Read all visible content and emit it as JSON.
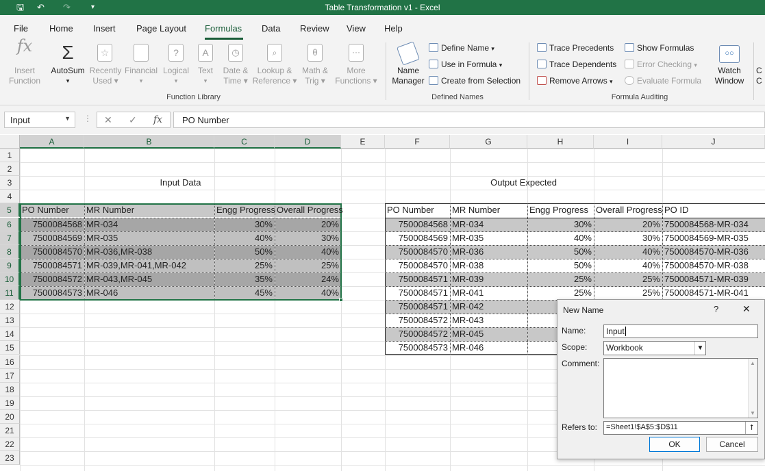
{
  "window": {
    "title": "Table Transformation v1  -  Excel"
  },
  "menu": [
    "File",
    "Home",
    "Insert",
    "Page Layout",
    "Formulas",
    "Data",
    "Review",
    "View",
    "Help"
  ],
  "ribbon": {
    "insert_function": [
      "Insert",
      "Function"
    ],
    "autosum": "AutoSum",
    "recently_used": [
      "Recently",
      "Used"
    ],
    "financial": "Financial",
    "logical": "Logical",
    "text": "Text",
    "date_time": [
      "Date &",
      "Time"
    ],
    "lookup": [
      "Lookup &",
      "Reference"
    ],
    "math": [
      "Math &",
      "Trig"
    ],
    "more": [
      "More",
      "Functions"
    ],
    "function_library": "Function Library",
    "name_manager": [
      "Name",
      "Manager"
    ],
    "define_name": "Define Name",
    "use_in_formula": "Use in Formula",
    "create_from_selection": "Create from Selection",
    "defined_names": "Defined Names",
    "trace_precedents": "Trace Precedents",
    "trace_dependents": "Trace Dependents",
    "remove_arrows": "Remove Arrows",
    "show_formulas": "Show Formulas",
    "error_checking": "Error Checking",
    "evaluate_formula": "Evaluate Formula",
    "watch_window": [
      "Watch",
      "Window"
    ],
    "formula_auditing": "Formula Auditing",
    "cut_off": [
      "C",
      "C"
    ]
  },
  "formula_bar": {
    "name_box": "Input",
    "fx": "fx",
    "content": "PO Number"
  },
  "columns": [
    "A",
    "B",
    "C",
    "D",
    "E",
    "F",
    "G",
    "H",
    "I",
    "J"
  ],
  "rows": [
    "1",
    "2",
    "3",
    "4",
    "5",
    "6",
    "7",
    "8",
    "9",
    "10",
    "11",
    "12",
    "13",
    "14",
    "15",
    "16",
    "17",
    "18",
    "19",
    "20",
    "21",
    "22",
    "23"
  ],
  "input": {
    "title": "Input Data",
    "headers": [
      "PO Number",
      "MR Number",
      "Engg Progress",
      "Overall Progress"
    ],
    "rows": [
      [
        "7500084568",
        "MR-034",
        "30%",
        "20%"
      ],
      [
        "7500084569",
        "MR-035",
        "40%",
        "30%"
      ],
      [
        "7500084570",
        "MR-036,MR-038",
        "50%",
        "40%"
      ],
      [
        "7500084571",
        "MR-039,MR-041,MR-042",
        "25%",
        "25%"
      ],
      [
        "7500084572",
        "MR-043,MR-045",
        "35%",
        "24%"
      ],
      [
        "7500084573",
        "MR-046",
        "45%",
        "40%"
      ]
    ]
  },
  "output": {
    "title": "Output Expected",
    "headers": [
      "PO Number",
      "MR Number",
      "Engg Progress",
      "Overall Progress",
      "PO ID"
    ],
    "rows": [
      [
        "7500084568",
        "MR-034",
        "30%",
        "20%",
        "7500084568-MR-034"
      ],
      [
        "7500084569",
        "MR-035",
        "40%",
        "30%",
        "7500084569-MR-035"
      ],
      [
        "7500084570",
        "MR-036",
        "50%",
        "40%",
        "7500084570-MR-036"
      ],
      [
        "7500084570",
        "MR-038",
        "50%",
        "40%",
        "7500084570-MR-038"
      ],
      [
        "7500084571",
        "MR-039",
        "25%",
        "25%",
        "7500084571-MR-039"
      ],
      [
        "7500084571",
        "MR-041",
        "25%",
        "25%",
        "7500084571-MR-041"
      ],
      [
        "7500084571",
        "MR-042",
        "",
        "",
        ""
      ],
      [
        "7500084572",
        "MR-043",
        "",
        "",
        ""
      ],
      [
        "7500084572",
        "MR-045",
        "",
        "",
        ""
      ],
      [
        "7500084573",
        "MR-046",
        "",
        "",
        ""
      ]
    ]
  },
  "dialog": {
    "title": "New Name",
    "help": "?",
    "close": "✕",
    "name_label": "Name:",
    "name_value": "Input",
    "scope_label": "Scope:",
    "scope_value": "Workbook",
    "comment_label": "Comment:",
    "refers_label": "Refers to:",
    "refers_value": "=Sheet1!$A$5:$D$11",
    "ok": "OK",
    "cancel": "Cancel"
  },
  "colors": {
    "excel_green": "#217346",
    "selection_fill": "#a6a6a6",
    "row_alt": "#c4c4c4"
  }
}
